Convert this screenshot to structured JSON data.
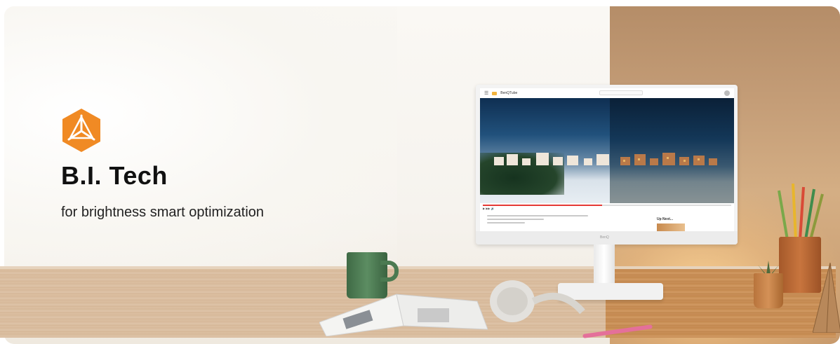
{
  "banner": {
    "title": "B.I. Tech",
    "subtitle": "for brightness smart optimization",
    "logo_icon": "hexagon-triangle-logo-icon",
    "accent_color": "#f08a24"
  },
  "monitor": {
    "brand": "BenQ",
    "screen": {
      "app_name": "BenQTube",
      "up_next_label": "Up Next..."
    }
  }
}
